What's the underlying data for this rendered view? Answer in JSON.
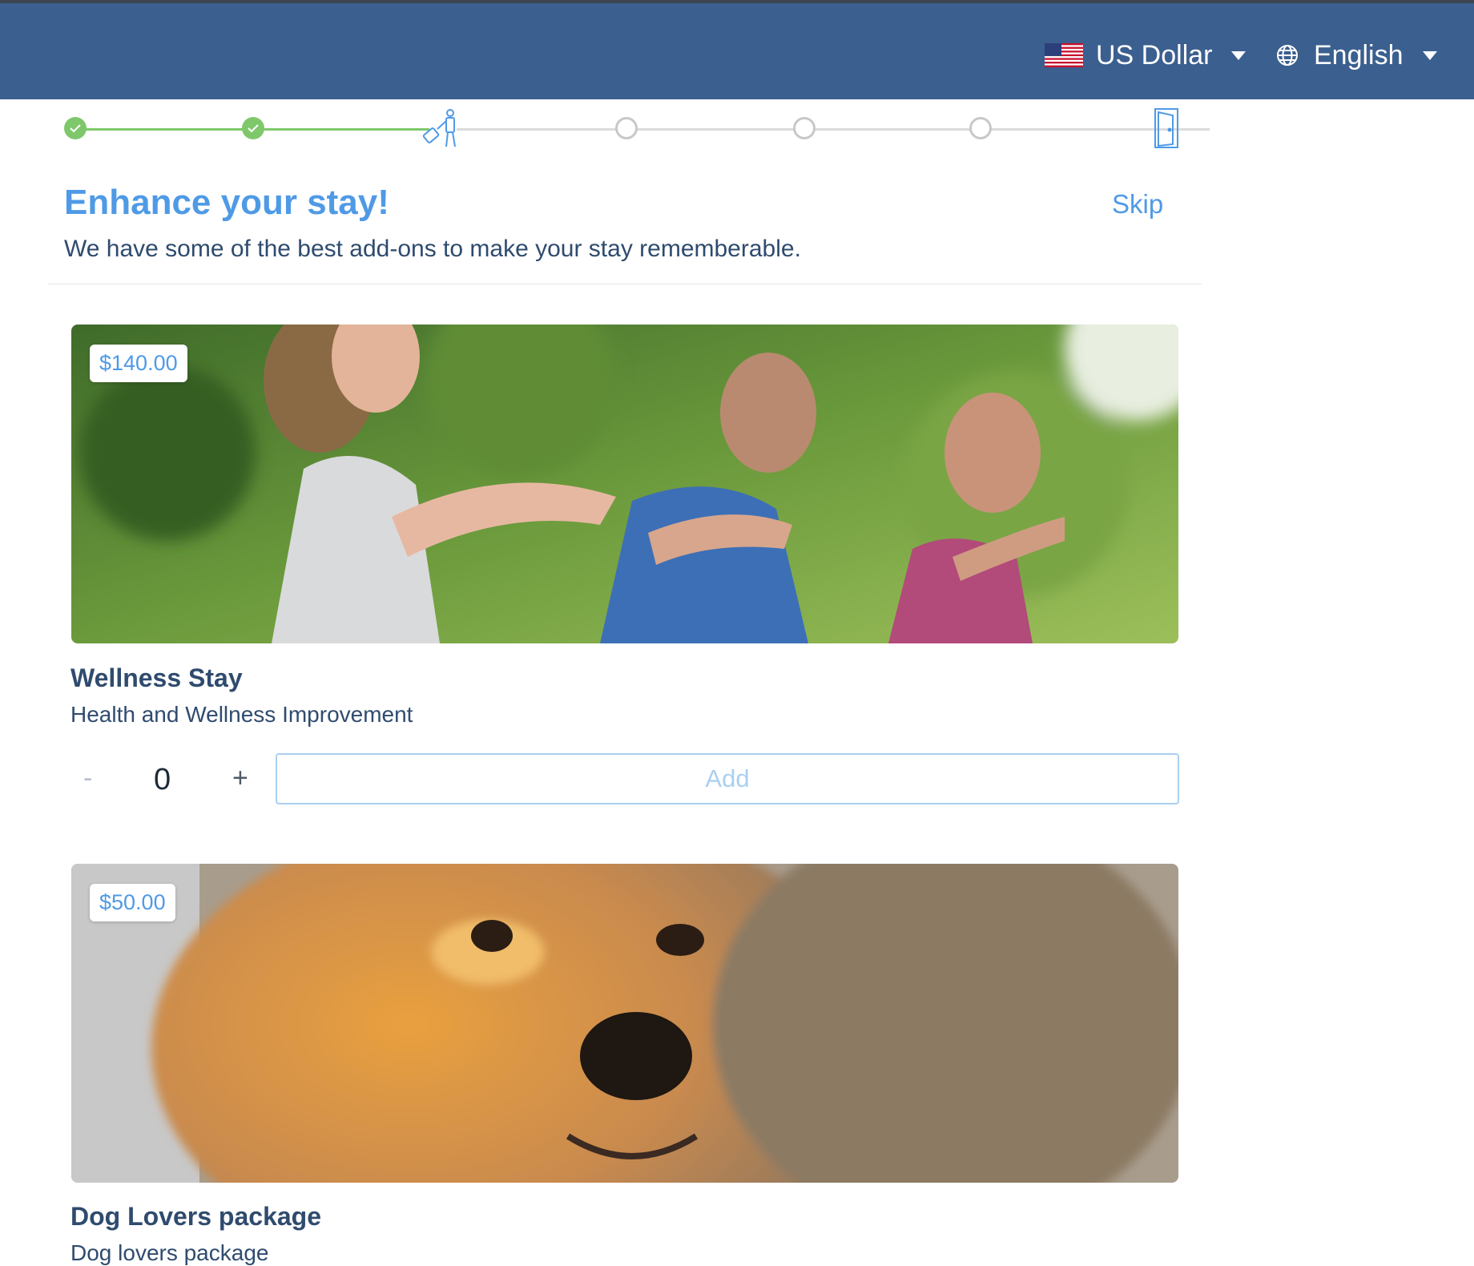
{
  "header": {
    "currency_label": "US Dollar",
    "language_label": "English"
  },
  "progress": {
    "completed_steps": 2,
    "current_step": 3,
    "total_steps": 7
  },
  "page": {
    "title": "Enhance your stay!",
    "skip_label": "Skip",
    "subtitle": "We have some of the best add-ons to make your stay rememberable."
  },
  "addons": [
    {
      "price": "$140.00",
      "title": "Wellness Stay",
      "description": "Health and Wellness Improvement",
      "quantity": "0",
      "minus_label": "-",
      "plus_label": "+",
      "add_label": "Add"
    },
    {
      "price": "$50.00",
      "title": "Dog Lovers package",
      "description": "Dog lovers package"
    }
  ],
  "colors": {
    "header_bg": "#3b5f8f",
    "accent": "#4f9ae6",
    "progress_done": "#7ec86b",
    "text_dark": "#2f4b6e"
  }
}
